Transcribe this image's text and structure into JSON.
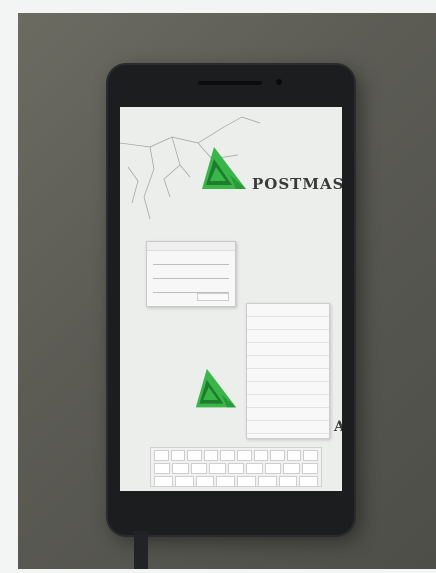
{
  "image": {
    "kind": "photograph of a smartphone screen",
    "screen_brand_text": "POSTMAS",
    "screen_brand_text_bottom": "AS",
    "colors": {
      "logo_green": "#3ab54a",
      "logo_dark": "#1e7d2c",
      "phone_body": "#1c1d1f",
      "screen_background": "#eceeec",
      "wall": "#5c5c55"
    },
    "icons": [
      "green-triangle-logo-icon",
      "green-triangle-logo-icon"
    ]
  }
}
